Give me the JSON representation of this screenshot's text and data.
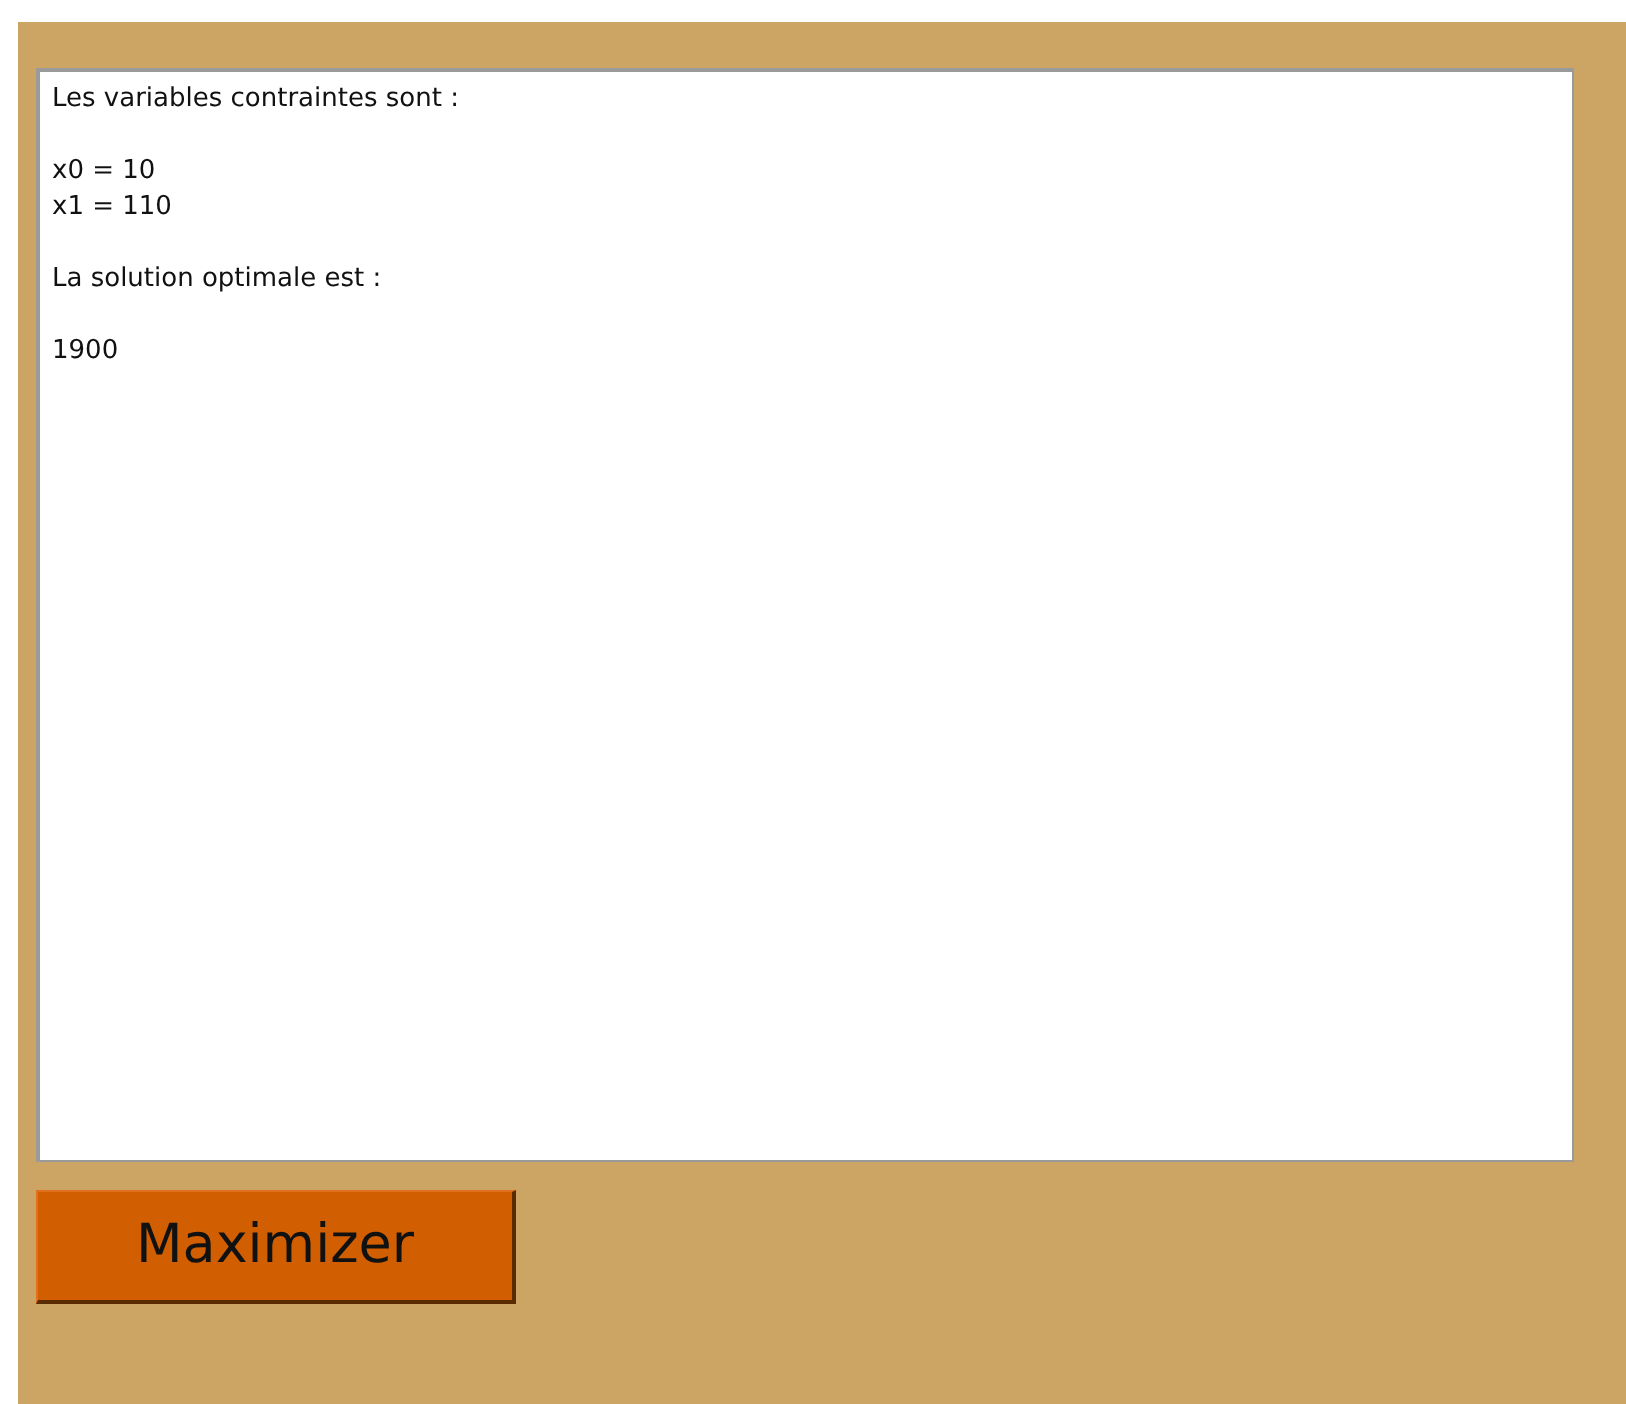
{
  "output": {
    "paragraphs": [
      {
        "lines": [
          "Les variables contraintes sont :"
        ]
      },
      {
        "lines": [
          "x0 = 10",
          "x1 = 110"
        ]
      },
      {
        "lines": [
          "La solution optimale est :"
        ]
      },
      {
        "lines": [
          "1900"
        ]
      }
    ]
  },
  "button": {
    "label": "Maximizer"
  }
}
